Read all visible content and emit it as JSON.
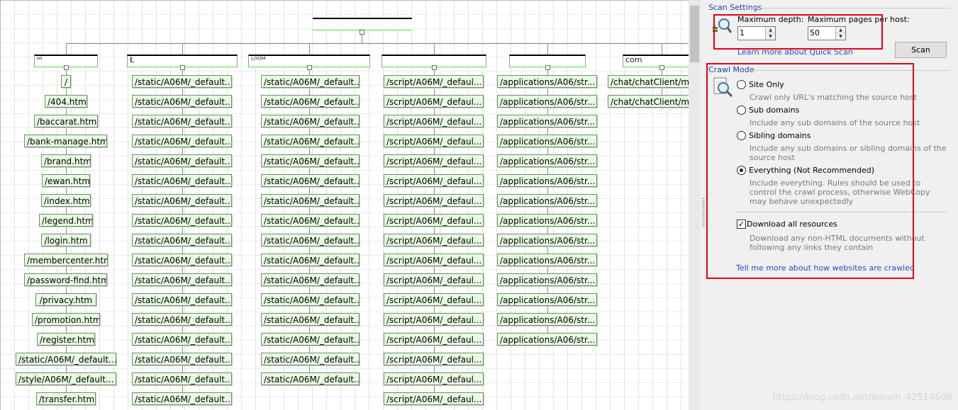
{
  "tree": {
    "root_label": "",
    "columns": [
      {
        "header": "ᴴᴵ",
        "nodes": [
          "/",
          "/404.htm",
          "/baccarat.htm",
          "/bank-manage.htm",
          "/brand.htm",
          "/ewan.htm",
          "/index.htm",
          "/legend.htm",
          "/login.htm",
          "/membercenter.htm",
          "/password-find.htm",
          "/privacy.htm",
          "/promotion.htm",
          "/register.htm",
          "/static/A06M/_default...",
          "/style/A06M/_default...",
          "/transfer.htm"
        ]
      },
      {
        "header": "Ł",
        "nodes": [
          "/static/A06M/_default...",
          "/static/A06M/_default...",
          "/static/A06M/_default...",
          "/static/A06M/_default...",
          "/static/A06M/_default...",
          "/static/A06M/_default...",
          "/static/A06M/_default...",
          "/static/A06M/_default...",
          "/static/A06M/_default...",
          "/static/A06M/_default...",
          "/static/A06M/_default...",
          "/static/A06M/_default...",
          "/static/A06M/_default...",
          "/static/A06M/_default...",
          "/static/A06M/_default...",
          "/static/A06M/_default...",
          "/static/A06M/_default..."
        ]
      },
      {
        "header": "ᴸᴼᴼᴹ",
        "nodes": [
          "/static/A06M/_default...",
          "/static/A06M/_default...",
          "/static/A06M/_default...",
          "/static/A06M/_default...",
          "/static/A06M/_default...",
          "/static/A06M/_default...",
          "/static/A06M/_default...",
          "/static/A06M/_default...",
          "/static/A06M/_default...",
          "/static/A06M/_default...",
          "/static/A06M/_default...",
          "/static/A06M/_default...",
          "/static/A06M/_default...",
          "/static/A06M/_default...",
          "/static/A06M/_default...",
          "/static/A06M/_default..."
        ]
      },
      {
        "header": "",
        "nodes": [
          "/script/A06M/_defaul...",
          "/script/A06M/_defaul...",
          "/script/A06M/_defaul...",
          "/script/A06M/_defaul...",
          "/script/A06M/_defaul...",
          "/script/A06M/_defaul...",
          "/script/A06M/_defaul...",
          "/script/A06M/_defaul...",
          "/script/A06M/_defaul...",
          "/script/A06M/_defaul...",
          "/script/A06M/_defaul...",
          "/script/A06M/_defaul...",
          "/script/A06M/_defaul...",
          "/script/A06M/_defaul...",
          "/script/A06M/_defaul...",
          "/script/A06M/_defaul...",
          "/script/A06M/_defaul..."
        ]
      },
      {
        "header": "",
        "nodes": [
          "/applications/A06/str...",
          "/applications/A06/str...",
          "/applications/A06/str...",
          "/applications/A06/str...",
          "/applications/A06/str...",
          "/applications/A06/str...",
          "/applications/A06/str...",
          "/applications/A06/str...",
          "/applications/A06/str...",
          "/applications/A06/str...",
          "/applications/A06/str...",
          "/applications/A06/str...",
          "/applications/A06/str...",
          "/applications/A06/str..."
        ]
      },
      {
        "header": "com",
        "nodes": [
          "/chat/chatClient/mo",
          "/chat/chatClient/mo"
        ]
      }
    ]
  },
  "scan_settings": {
    "title": "Scan Settings",
    "max_depth_label": "Maximum depth:",
    "max_depth_value": "1",
    "max_pages_label": "Maximum pages per host:",
    "max_pages_value": "50",
    "learn_more_link": "Learn more about Quick Scan",
    "scan_button": "Scan"
  },
  "crawl_mode": {
    "title": "Crawl Mode",
    "options": [
      {
        "label": "Site Only",
        "desc": "Crawl only URL's matching the source host",
        "selected": false
      },
      {
        "label": "Sub domains",
        "desc": "Include any sub domains of the source host",
        "selected": false
      },
      {
        "label": "Sibling domains",
        "desc": "Include any sub domains or sibling domains of the source host",
        "selected": false
      },
      {
        "label": "Everything (Not Recommended)",
        "desc": "Include everything. Rules should be used to control the crawl process, otherwise WebCopy may behave unexpectedly",
        "selected": true
      }
    ],
    "download_all_label": "Download all resources",
    "download_all_checked": true,
    "download_all_desc": "Download any non-HTML documents without following any links they contain",
    "tell_me_more_link": "Tell me more about how websites are crawled"
  },
  "watermark": "https://blog.csdn.net/weixin_42514606",
  "colors": {
    "highlight_box": "#e0001b",
    "link": "#1f52c9",
    "group_title": "#1f3fa8",
    "node_fill": "#e8fbe3"
  }
}
